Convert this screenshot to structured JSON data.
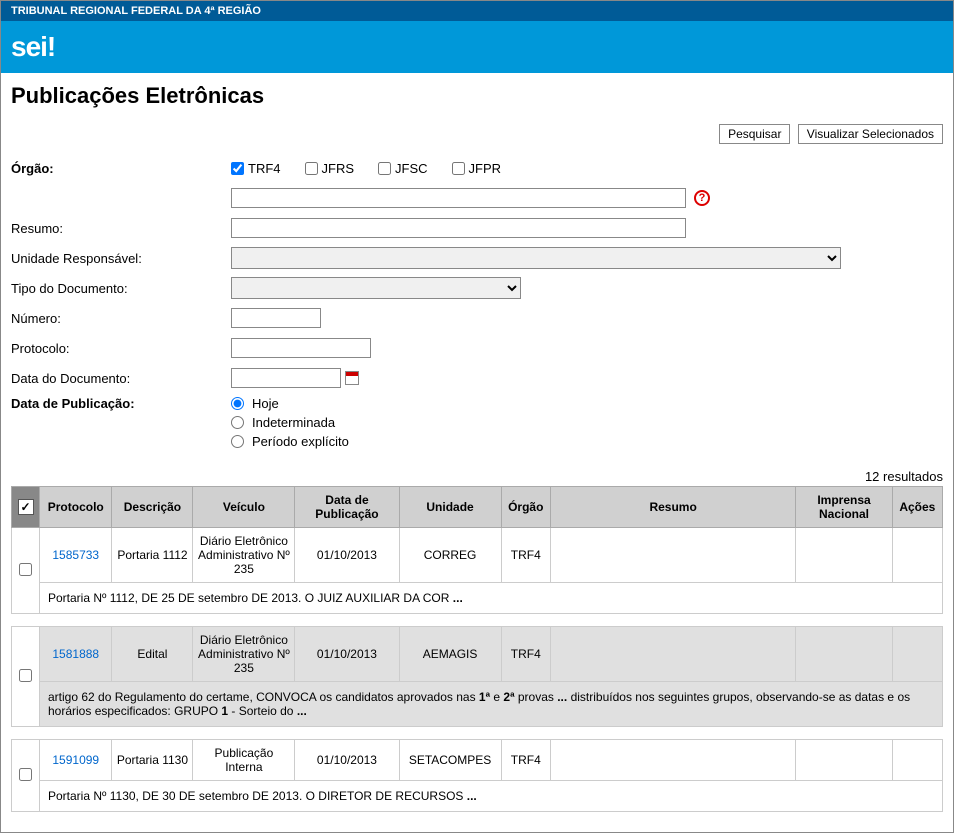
{
  "header": {
    "org_name": "TRIBUNAL REGIONAL FEDERAL DA 4ª REGIÃO",
    "logo_text": "sei!"
  },
  "page": {
    "title": "Publicações Eletrônicas"
  },
  "buttons": {
    "pesquisar": "Pesquisar",
    "visualizar": "Visualizar Selecionados"
  },
  "form": {
    "orgao_label": "Órgão:",
    "orgao_options": [
      {
        "label": "TRF4",
        "checked": true
      },
      {
        "label": "JFRS",
        "checked": false
      },
      {
        "label": "JFSC",
        "checked": false
      },
      {
        "label": "JFPR",
        "checked": false
      }
    ],
    "resumo_label": "Resumo:",
    "unidade_label": "Unidade Responsável:",
    "tipo_doc_label": "Tipo do Documento:",
    "numero_label": "Número:",
    "protocolo_label": "Protocolo:",
    "data_doc_label": "Data do Documento:",
    "data_pub_label": "Data de Publicação:",
    "data_pub_options": {
      "hoje": "Hoje",
      "indeterminada": "Indeterminada",
      "periodo": "Período explícito"
    }
  },
  "results": {
    "count_text": "12 resultados",
    "headers": {
      "protocolo": "Protocolo",
      "descricao": "Descrição",
      "veiculo": "Veículo",
      "data_pub": "Data de Publicação",
      "unidade": "Unidade",
      "orgao": "Órgão",
      "resumo": "Resumo",
      "imprensa": "Imprensa Nacional",
      "acoes": "Ações"
    },
    "rows": [
      {
        "protocolo": "1585733",
        "descricao": "Portaria 1112",
        "veiculo": "Diário Eletrônico Administrativo Nº 235",
        "data_pub": "01/10/2013",
        "unidade": "CORREG",
        "orgao": "TRF4",
        "resumo": "",
        "summary": "Portaria Nº 1112, DE 25 DE setembro DE 2013. O JUIZ AUXILIAR DA COR",
        "alt": false
      },
      {
        "protocolo": "1581888",
        "descricao": "Edital",
        "veiculo": "Diário Eletrônico Administrativo Nº 235",
        "data_pub": "01/10/2013",
        "unidade": "AEMAGIS",
        "orgao": "TRF4",
        "resumo": "",
        "summary_a": "artigo 62 do Regulamento do certame, CONVOCA os candidatos aprovados nas ",
        "summary_b": "1ª",
        "summary_c": " e ",
        "summary_d": "2ª",
        "summary_e": " provas",
        "summary_f": "  distribuídos nos seguintes grupos, observando-se as datas e os horários especificados: GRUPO ",
        "summary_g": "1",
        "summary_h": " - Sorteio do",
        "alt": true
      },
      {
        "protocolo": "1591099",
        "descricao": "Portaria 1130",
        "veiculo": "Publicação Interna",
        "data_pub": "01/10/2013",
        "unidade": "SETACOMPES",
        "orgao": "TRF4",
        "resumo": "",
        "summary": "Portaria Nº 1130, DE 30 DE setembro DE 2013. O DIRETOR DE RECURSOS",
        "alt": false
      }
    ]
  }
}
